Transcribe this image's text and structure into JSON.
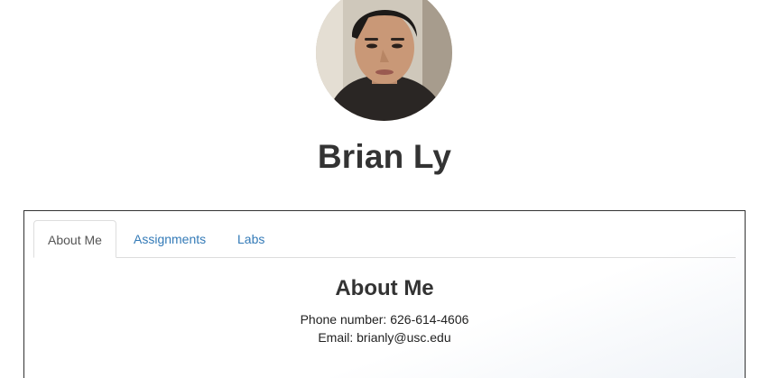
{
  "profile": {
    "name": "Brian Ly"
  },
  "tabs": [
    {
      "label": "About Me",
      "active": true
    },
    {
      "label": "Assignments",
      "active": false
    },
    {
      "label": "Labs",
      "active": false
    }
  ],
  "about": {
    "heading": "About Me",
    "phone_label": "Phone number:",
    "phone_value": "626-614-4606",
    "email_label": "Email:",
    "email_value": "brianly@usc.edu"
  },
  "colors": {
    "link": "#337ab7",
    "text": "#333333",
    "tab_border": "#dddddd"
  }
}
